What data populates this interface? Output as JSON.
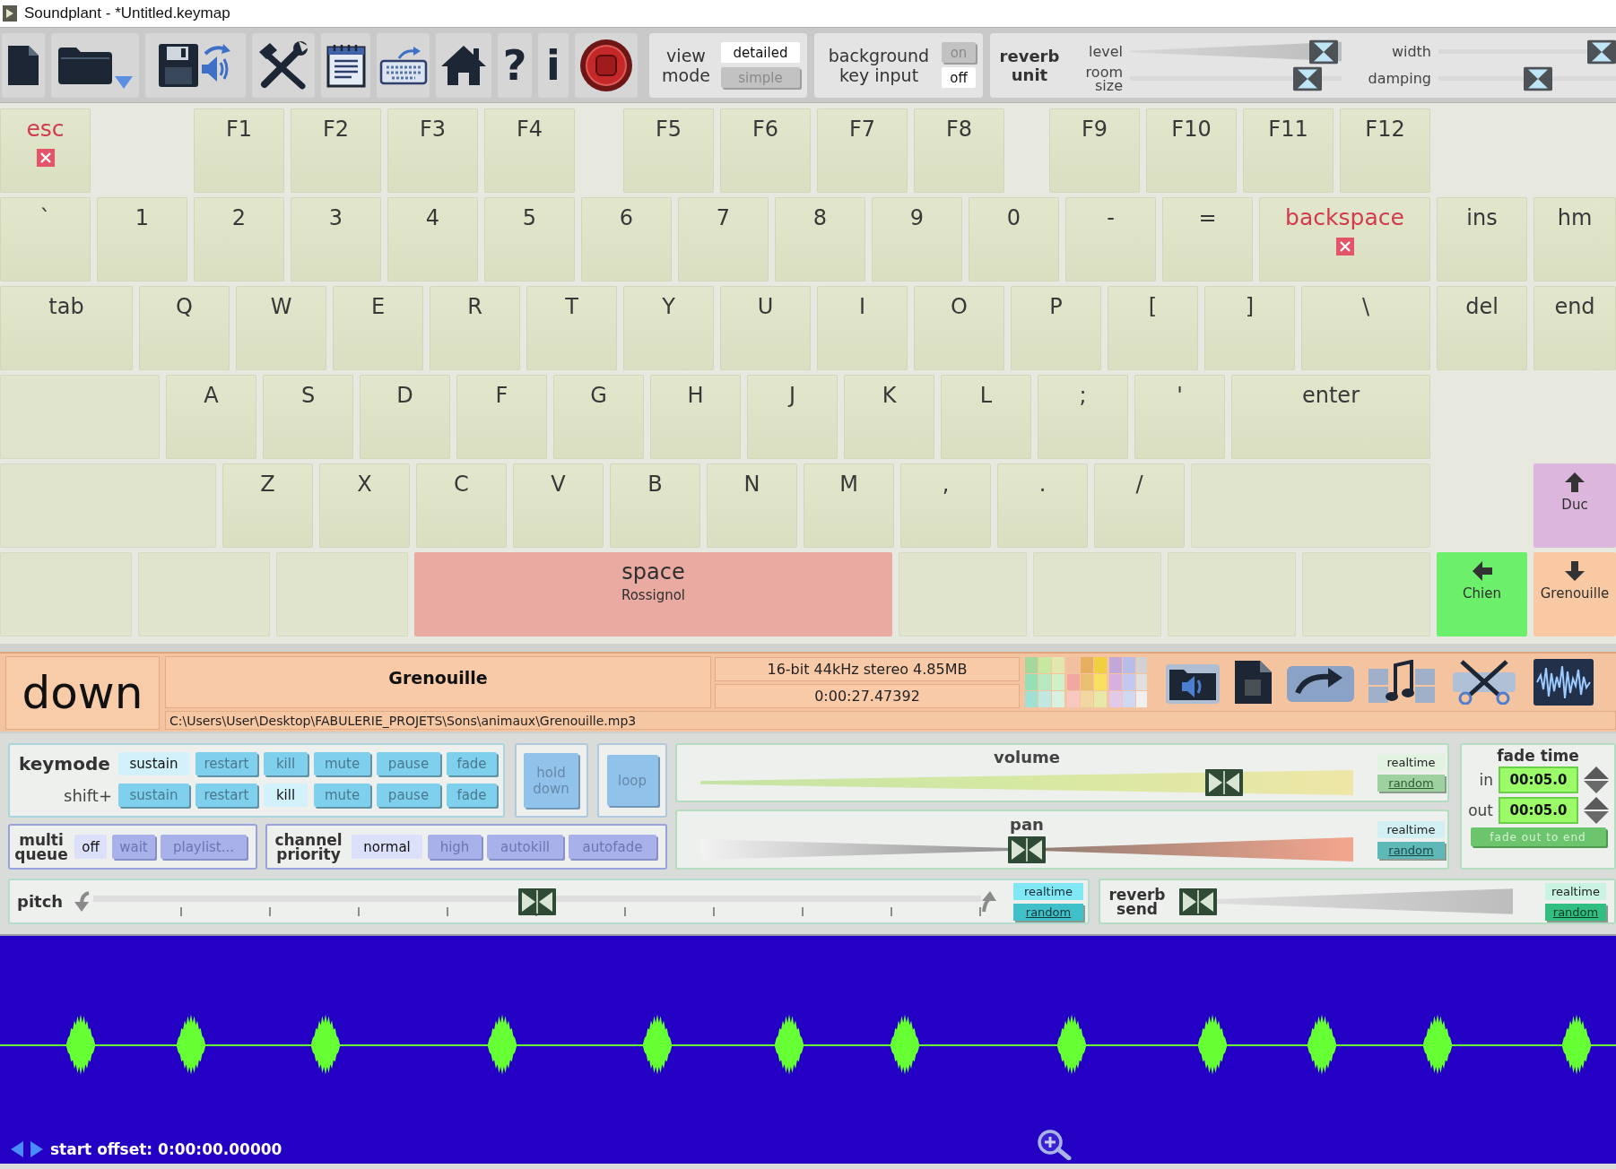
{
  "window": {
    "title": "Soundplant - *Untitled.keymap"
  },
  "toolbar": {
    "help": "?",
    "info": "i",
    "view_mode": {
      "label": "view mode",
      "options": [
        {
          "label": "detailed",
          "selected": true
        },
        {
          "label": "simple",
          "selected": false
        }
      ]
    },
    "background_key_input": {
      "label": "background key input",
      "options": [
        {
          "label": "on",
          "selected": false
        },
        {
          "label": "off",
          "selected": true
        }
      ]
    },
    "reverb_unit": {
      "label": "reverb unit",
      "sliders": [
        {
          "label": "level",
          "kind": "wedge",
          "level": 0.98
        },
        {
          "label": "width",
          "kind": "flat",
          "level": 1
        },
        {
          "label": "room size",
          "kind": "flat",
          "level": 0.89
        },
        {
          "label": "damping",
          "kind": "flat",
          "level": 0.57
        }
      ]
    }
  },
  "keyboard": {
    "rows": [
      {
        "keys": [
          {
            "label": "esc",
            "kind": "control"
          },
          {
            "label": "F1",
            "kind": "key"
          },
          {
            "label": "F2",
            "kind": "key"
          },
          {
            "label": "F3",
            "kind": "key"
          },
          {
            "label": "F4",
            "kind": "key"
          },
          {
            "label": "F5",
            "kind": "key"
          },
          {
            "label": "F6",
            "kind": "key"
          },
          {
            "label": "F7",
            "kind": "key"
          },
          {
            "label": "F8",
            "kind": "key"
          },
          {
            "label": "F9",
            "kind": "key"
          },
          {
            "label": "F10",
            "kind": "key"
          },
          {
            "label": "F11",
            "kind": "key"
          },
          {
            "label": "F12",
            "kind": "key"
          }
        ]
      },
      {
        "keys": [
          {
            "label": "`",
            "kind": "key"
          },
          {
            "label": "1",
            "kind": "key"
          },
          {
            "label": "2",
            "kind": "key"
          },
          {
            "label": "3",
            "kind": "key"
          },
          {
            "label": "4",
            "kind": "key"
          },
          {
            "label": "5",
            "kind": "key"
          },
          {
            "label": "6",
            "kind": "key"
          },
          {
            "label": "7",
            "kind": "key"
          },
          {
            "label": "8",
            "kind": "key"
          },
          {
            "label": "9",
            "kind": "key"
          },
          {
            "label": "0",
            "kind": "key"
          },
          {
            "label": "-",
            "kind": "key"
          },
          {
            "label": "=",
            "kind": "key"
          },
          {
            "label": "backspace",
            "kind": "control"
          },
          {
            "label": "ins",
            "kind": "key"
          },
          {
            "label": "hm",
            "kind": "key"
          }
        ]
      },
      {
        "keys": [
          {
            "label": "tab",
            "kind": "key"
          },
          {
            "label": "Q",
            "kind": "key"
          },
          {
            "label": "W",
            "kind": "key"
          },
          {
            "label": "E",
            "kind": "key"
          },
          {
            "label": "R",
            "kind": "key"
          },
          {
            "label": "T",
            "kind": "key"
          },
          {
            "label": "Y",
            "kind": "key"
          },
          {
            "label": "U",
            "kind": "key"
          },
          {
            "label": "I",
            "kind": "key"
          },
          {
            "label": "O",
            "kind": "key"
          },
          {
            "label": "P",
            "kind": "key"
          },
          {
            "label": "[",
            "kind": "key"
          },
          {
            "label": "]",
            "kind": "key"
          },
          {
            "label": "\\",
            "kind": "key"
          },
          {
            "label": "del",
            "kind": "key"
          },
          {
            "label": "end",
            "kind": "key"
          }
        ]
      },
      {
        "keys": [
          {
            "kind": "blank"
          },
          {
            "label": "A",
            "kind": "key"
          },
          {
            "label": "S",
            "kind": "key"
          },
          {
            "label": "D",
            "kind": "key"
          },
          {
            "label": "F",
            "kind": "key"
          },
          {
            "label": "G",
            "kind": "key"
          },
          {
            "label": "H",
            "kind": "key"
          },
          {
            "label": "J",
            "kind": "key"
          },
          {
            "label": "K",
            "kind": "key"
          },
          {
            "label": "L",
            "kind": "key"
          },
          {
            "label": ";",
            "kind": "key"
          },
          {
            "label": "'",
            "kind": "key"
          },
          {
            "label": "enter",
            "kind": "key"
          }
        ]
      },
      {
        "keys": [
          {
            "kind": "blank"
          },
          {
            "label": "Z",
            "kind": "key"
          },
          {
            "label": "X",
            "kind": "key"
          },
          {
            "label": "C",
            "kind": "key"
          },
          {
            "label": "V",
            "kind": "key"
          },
          {
            "label": "B",
            "kind": "key"
          },
          {
            "label": "N",
            "kind": "key"
          },
          {
            "label": "M",
            "kind": "key"
          },
          {
            "label": ",",
            "kind": "key"
          },
          {
            "label": ".",
            "kind": "key"
          },
          {
            "label": "/",
            "kind": "key"
          },
          {
            "kind": "blank"
          },
          {
            "kind": "up",
            "sound": "Duc",
            "color": "#dcb6dc"
          }
        ]
      },
      {
        "keys": [
          {
            "kind": "blank"
          },
          {
            "kind": "blank"
          },
          {
            "kind": "blank"
          },
          {
            "kind": "sound",
            "label": "space",
            "sound": "Rossignol",
            "color": "#e9aaa2"
          },
          {
            "kind": "blank"
          },
          {
            "kind": "blank"
          },
          {
            "kind": "blank"
          },
          {
            "kind": "blank"
          },
          {
            "kind": "left",
            "sound": "Chien",
            "color": "#6cf06c"
          },
          {
            "kind": "down",
            "sound": "Grenouille",
            "color": "#f9c9a3"
          }
        ]
      }
    ]
  },
  "key_info": {
    "key": "down",
    "sound": "Grenouille",
    "format": "16-bit 44kHz stereo 4.85MB",
    "duration": "0:00:27.47392",
    "path": "C:\\Users\\User\\Desktop\\FABULERIE_PROJETS\\Sons\\animaux\\Grenouille.mp3"
  },
  "keymode": {
    "label": "keymode",
    "modes": [
      {
        "label": "sustain",
        "selected": true
      },
      {
        "label": "restart",
        "selected": false
      },
      {
        "label": "kill",
        "selected": false
      },
      {
        "label": "mute",
        "selected": false
      },
      {
        "label": "pause",
        "selected": false
      },
      {
        "label": "fade",
        "selected": false
      }
    ],
    "shift_label": "shift+",
    "shift_modes": [
      {
        "label": "sustain",
        "selected": false
      },
      {
        "label": "restart",
        "selected": false
      },
      {
        "label": "kill",
        "selected": true
      },
      {
        "label": "mute",
        "selected": false
      },
      {
        "label": "pause",
        "selected": false
      },
      {
        "label": "fade",
        "selected": false
      }
    ]
  },
  "hold_down": {
    "label": "hold down",
    "on": false
  },
  "loop": {
    "label": "loop",
    "on": false
  },
  "multi_queue": {
    "label": "multi queue",
    "options": [
      {
        "label": "off",
        "selected": true
      },
      {
        "label": "wait",
        "selected": false
      },
      {
        "label": "playlist...",
        "selected": false
      }
    ]
  },
  "channel_priority": {
    "label": "channel priority",
    "options": [
      {
        "label": "normal",
        "selected": true
      },
      {
        "label": "high",
        "selected": false
      },
      {
        "label": "autokill",
        "selected": false
      },
      {
        "label": "autofade",
        "selected": false
      }
    ]
  },
  "volume": {
    "label": "volume",
    "level": 0.82,
    "realtime": "realtime",
    "random": "random"
  },
  "pan": {
    "label": "pan",
    "level": 0.5,
    "realtime": "realtime",
    "random": "random"
  },
  "fade_time": {
    "label": "fade time",
    "in_label": "in",
    "in_value": "00:05.0",
    "out_label": "out",
    "out_value": "00:05.0",
    "button": "fade out to end"
  },
  "pitch": {
    "label": "pitch",
    "level": 0.5,
    "realtime": "realtime",
    "random": "random"
  },
  "reverb_send": {
    "label": "reverb send",
    "level": 0,
    "realtime": "realtime",
    "random": "random"
  },
  "waveform": {
    "start_offset": "start offset: 0:00:00.00000"
  }
}
